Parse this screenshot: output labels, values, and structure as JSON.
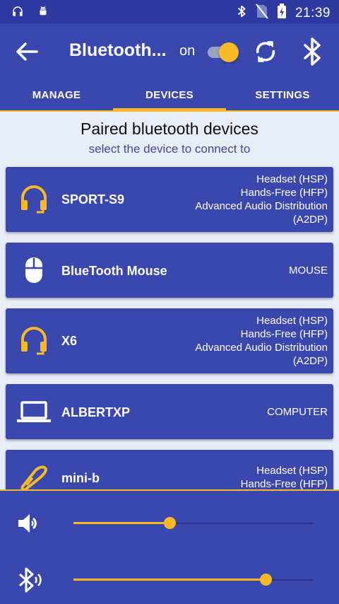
{
  "status_bar": {
    "time": "21:39"
  },
  "app_bar": {
    "title": "Bluetooth...",
    "toggle_label": "on",
    "toggle_on": true
  },
  "tabs": [
    {
      "label": "MANAGE",
      "active": false
    },
    {
      "label": "DEVICES",
      "active": true
    },
    {
      "label": "SETTINGS",
      "active": false
    }
  ],
  "content": {
    "heading": "Paired bluetooth devices",
    "subheading": "select the device to connect to"
  },
  "devices": [
    {
      "name": "SPORT-S9",
      "icon": "headset-icon",
      "services": [
        "Headset (HSP)",
        "Hands-Free (HFP)",
        "Advanced Audio Distribution",
        "(A2DP)"
      ]
    },
    {
      "name": "BlueTooth Mouse",
      "icon": "mouse-icon",
      "services": [
        "MOUSE"
      ]
    },
    {
      "name": "X6",
      "icon": "headset-icon",
      "services": [
        "Headset (HSP)",
        "Hands-Free (HFP)",
        "Advanced Audio Distribution",
        "(A2DP)"
      ]
    },
    {
      "name": "ALBERTXP",
      "icon": "laptop-icon",
      "services": [
        "COMPUTER"
      ]
    },
    {
      "name": "mini-b",
      "icon": "bluetooth-earpiece-icon",
      "services": [
        "Headset (HSP)",
        "Hands-Free (HFP)"
      ]
    }
  ],
  "sliders": {
    "media_volume": {
      "icon": "volume-icon",
      "level": 0.4
    },
    "bluetooth_volume": {
      "icon": "bluetooth-audio-icon",
      "level": 0.8
    }
  },
  "colors": {
    "primary": "#3a47ad",
    "status_bar": "#2f3aa0",
    "accent": "#f7b928",
    "background": "#e8ecf5"
  }
}
